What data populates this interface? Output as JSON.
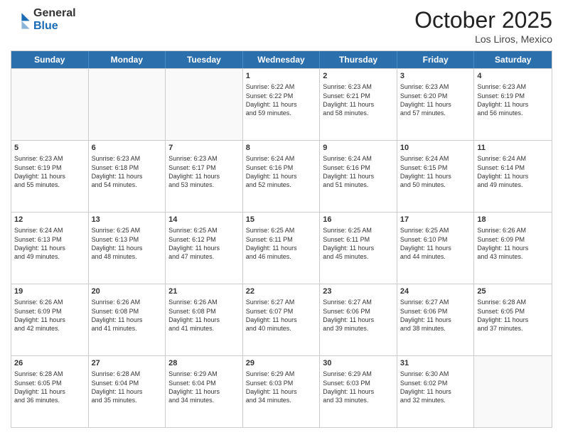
{
  "header": {
    "logo_general": "General",
    "logo_blue": "Blue",
    "month_title": "October 2025",
    "location": "Los Liros, Mexico"
  },
  "weekdays": [
    "Sunday",
    "Monday",
    "Tuesday",
    "Wednesday",
    "Thursday",
    "Friday",
    "Saturday"
  ],
  "rows": [
    [
      {
        "day": "",
        "text": "",
        "empty": true
      },
      {
        "day": "",
        "text": "",
        "empty": true
      },
      {
        "day": "",
        "text": "",
        "empty": true
      },
      {
        "day": "1",
        "text": "Sunrise: 6:22 AM\nSunset: 6:22 PM\nDaylight: 11 hours\nand 59 minutes."
      },
      {
        "day": "2",
        "text": "Sunrise: 6:23 AM\nSunset: 6:21 PM\nDaylight: 11 hours\nand 58 minutes."
      },
      {
        "day": "3",
        "text": "Sunrise: 6:23 AM\nSunset: 6:20 PM\nDaylight: 11 hours\nand 57 minutes."
      },
      {
        "day": "4",
        "text": "Sunrise: 6:23 AM\nSunset: 6:19 PM\nDaylight: 11 hours\nand 56 minutes."
      }
    ],
    [
      {
        "day": "5",
        "text": "Sunrise: 6:23 AM\nSunset: 6:19 PM\nDaylight: 11 hours\nand 55 minutes."
      },
      {
        "day": "6",
        "text": "Sunrise: 6:23 AM\nSunset: 6:18 PM\nDaylight: 11 hours\nand 54 minutes."
      },
      {
        "day": "7",
        "text": "Sunrise: 6:23 AM\nSunset: 6:17 PM\nDaylight: 11 hours\nand 53 minutes."
      },
      {
        "day": "8",
        "text": "Sunrise: 6:24 AM\nSunset: 6:16 PM\nDaylight: 11 hours\nand 52 minutes."
      },
      {
        "day": "9",
        "text": "Sunrise: 6:24 AM\nSunset: 6:16 PM\nDaylight: 11 hours\nand 51 minutes."
      },
      {
        "day": "10",
        "text": "Sunrise: 6:24 AM\nSunset: 6:15 PM\nDaylight: 11 hours\nand 50 minutes."
      },
      {
        "day": "11",
        "text": "Sunrise: 6:24 AM\nSunset: 6:14 PM\nDaylight: 11 hours\nand 49 minutes."
      }
    ],
    [
      {
        "day": "12",
        "text": "Sunrise: 6:24 AM\nSunset: 6:13 PM\nDaylight: 11 hours\nand 49 minutes."
      },
      {
        "day": "13",
        "text": "Sunrise: 6:25 AM\nSunset: 6:13 PM\nDaylight: 11 hours\nand 48 minutes."
      },
      {
        "day": "14",
        "text": "Sunrise: 6:25 AM\nSunset: 6:12 PM\nDaylight: 11 hours\nand 47 minutes."
      },
      {
        "day": "15",
        "text": "Sunrise: 6:25 AM\nSunset: 6:11 PM\nDaylight: 11 hours\nand 46 minutes."
      },
      {
        "day": "16",
        "text": "Sunrise: 6:25 AM\nSunset: 6:11 PM\nDaylight: 11 hours\nand 45 minutes."
      },
      {
        "day": "17",
        "text": "Sunrise: 6:25 AM\nSunset: 6:10 PM\nDaylight: 11 hours\nand 44 minutes."
      },
      {
        "day": "18",
        "text": "Sunrise: 6:26 AM\nSunset: 6:09 PM\nDaylight: 11 hours\nand 43 minutes."
      }
    ],
    [
      {
        "day": "19",
        "text": "Sunrise: 6:26 AM\nSunset: 6:09 PM\nDaylight: 11 hours\nand 42 minutes."
      },
      {
        "day": "20",
        "text": "Sunrise: 6:26 AM\nSunset: 6:08 PM\nDaylight: 11 hours\nand 41 minutes."
      },
      {
        "day": "21",
        "text": "Sunrise: 6:26 AM\nSunset: 6:08 PM\nDaylight: 11 hours\nand 41 minutes."
      },
      {
        "day": "22",
        "text": "Sunrise: 6:27 AM\nSunset: 6:07 PM\nDaylight: 11 hours\nand 40 minutes."
      },
      {
        "day": "23",
        "text": "Sunrise: 6:27 AM\nSunset: 6:06 PM\nDaylight: 11 hours\nand 39 minutes."
      },
      {
        "day": "24",
        "text": "Sunrise: 6:27 AM\nSunset: 6:06 PM\nDaylight: 11 hours\nand 38 minutes."
      },
      {
        "day": "25",
        "text": "Sunrise: 6:28 AM\nSunset: 6:05 PM\nDaylight: 11 hours\nand 37 minutes."
      }
    ],
    [
      {
        "day": "26",
        "text": "Sunrise: 6:28 AM\nSunset: 6:05 PM\nDaylight: 11 hours\nand 36 minutes."
      },
      {
        "day": "27",
        "text": "Sunrise: 6:28 AM\nSunset: 6:04 PM\nDaylight: 11 hours\nand 35 minutes."
      },
      {
        "day": "28",
        "text": "Sunrise: 6:29 AM\nSunset: 6:04 PM\nDaylight: 11 hours\nand 34 minutes."
      },
      {
        "day": "29",
        "text": "Sunrise: 6:29 AM\nSunset: 6:03 PM\nDaylight: 11 hours\nand 34 minutes."
      },
      {
        "day": "30",
        "text": "Sunrise: 6:29 AM\nSunset: 6:03 PM\nDaylight: 11 hours\nand 33 minutes."
      },
      {
        "day": "31",
        "text": "Sunrise: 6:30 AM\nSunset: 6:02 PM\nDaylight: 11 hours\nand 32 minutes."
      },
      {
        "day": "",
        "text": "",
        "empty": true
      }
    ]
  ]
}
